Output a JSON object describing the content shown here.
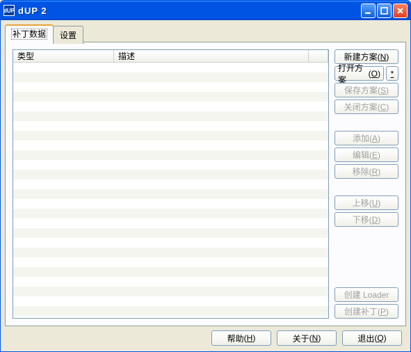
{
  "window": {
    "title": "dUP 2"
  },
  "tabs": {
    "patch_data": "补丁数据",
    "settings": "设置"
  },
  "columns": {
    "type": "类型",
    "desc": "描述"
  },
  "buttons": {
    "new_scheme": "新建方案",
    "new_scheme_key": "N",
    "open_scheme": "打开方案",
    "open_scheme_key": "O",
    "open_recent": "*",
    "save_scheme": "保存方案",
    "save_scheme_key": "S",
    "close_scheme": "关闭方案",
    "close_scheme_key": "C",
    "add": "添加",
    "add_key": "A",
    "edit": "编辑",
    "edit_key": "E",
    "remove": "移除",
    "remove_key": "R",
    "move_up": "上移",
    "move_up_key": "U",
    "move_down": "下移",
    "move_down_key": "D",
    "create_loader": "创建 Loader",
    "create_patch": "创建补丁",
    "create_patch_key": "P",
    "help": "帮助",
    "help_key": "H",
    "about": "关于",
    "about_key": "N",
    "exit": "退出",
    "exit_key": "Q"
  }
}
